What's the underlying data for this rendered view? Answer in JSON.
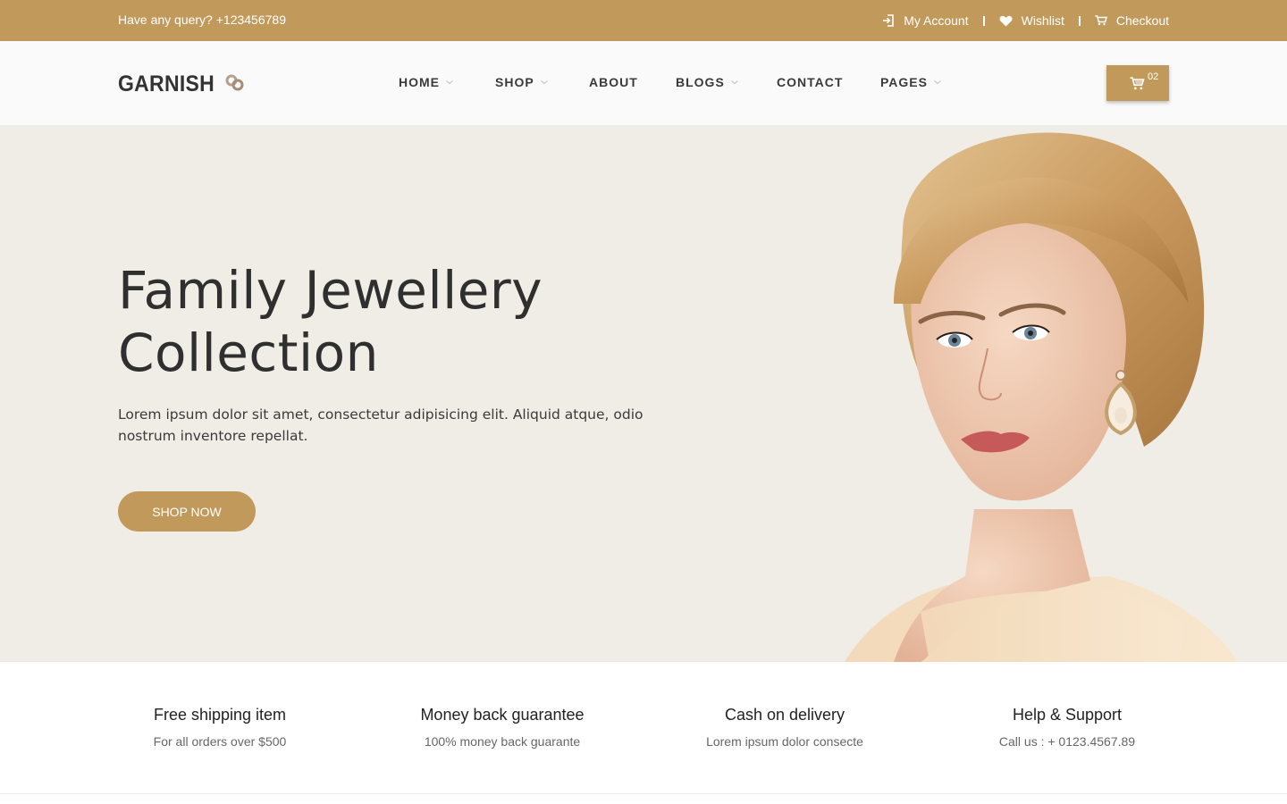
{
  "topbar": {
    "query": "Have any query? +123456789",
    "links": [
      {
        "label": "My Account",
        "icon": "sign-in-icon"
      },
      {
        "label": "Wishlist",
        "icon": "heart-icon"
      },
      {
        "label": "Checkout",
        "icon": "cart-icon"
      }
    ]
  },
  "header": {
    "logo": "GARNISH",
    "nav": [
      {
        "label": "HOME",
        "dropdown": true
      },
      {
        "label": "SHOP",
        "dropdown": true
      },
      {
        "label": "ABOUT",
        "dropdown": false
      },
      {
        "label": "BLOGS",
        "dropdown": true
      },
      {
        "label": "CONTACT",
        "dropdown": false
      },
      {
        "label": "PAGES",
        "dropdown": true
      }
    ],
    "cart_count": "02"
  },
  "hero": {
    "title_line1": "Family Jewellery",
    "title_line2": "Collection",
    "text": "Lorem ipsum dolor sit amet, consectetur adipisicing elit. Aliquid atque, odio nostrum inventore repellat.",
    "button": "SHOP NOW"
  },
  "features": [
    {
      "title": "Free shipping item",
      "desc": "For all orders over $500"
    },
    {
      "title": "Money back guarantee",
      "desc": "100% money back guarante"
    },
    {
      "title": "Cash on delivery",
      "desc": "Lorem ipsum dolor consecte"
    },
    {
      "title": "Help & Support",
      "desc": "Call us : + 0123.4567.89"
    }
  ],
  "colors": {
    "accent": "#c19a5b",
    "hero_bg": "#f0ece6",
    "text_dark": "#2f2f2f"
  }
}
